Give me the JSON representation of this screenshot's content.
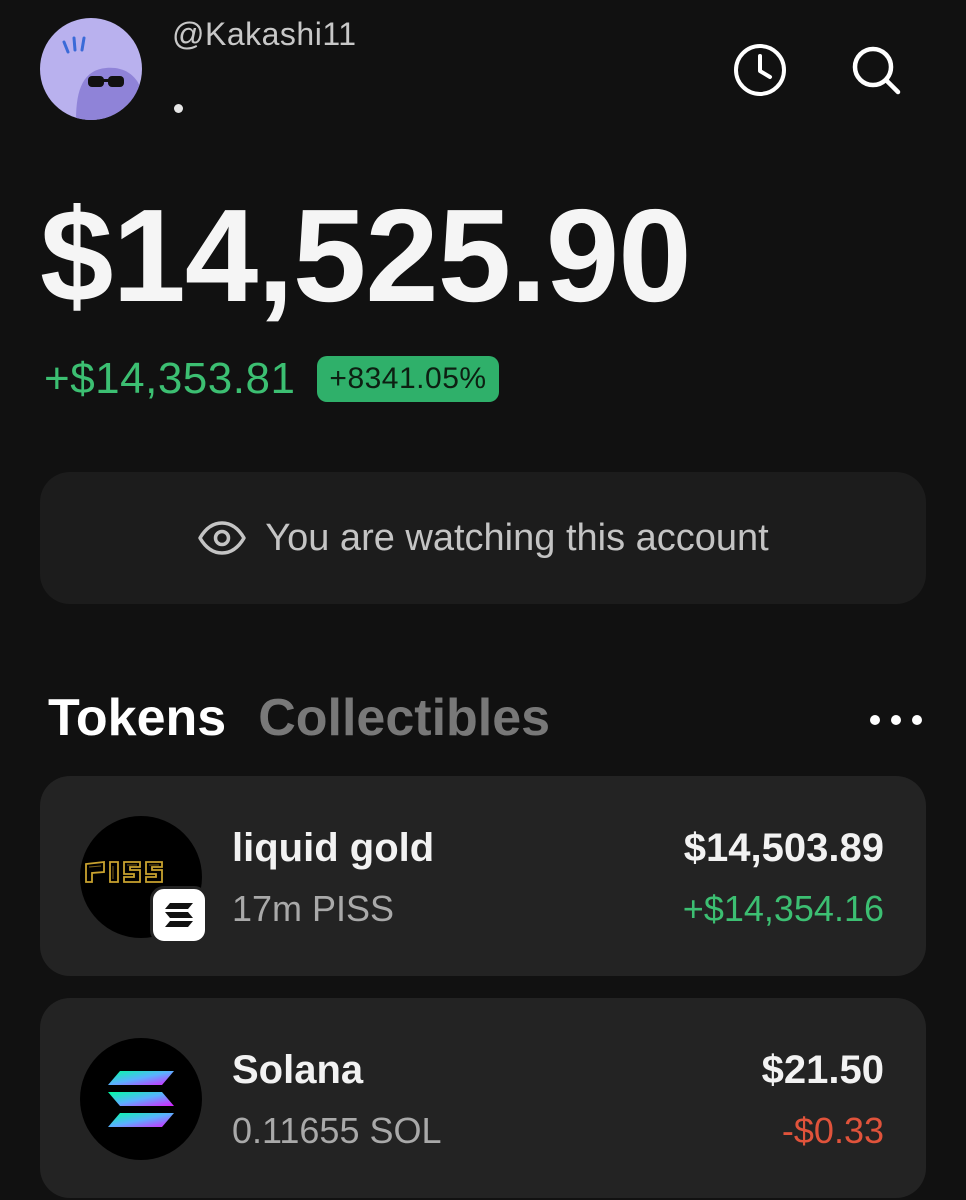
{
  "header": {
    "username": "@Kakashi11",
    "avatar_icon": "sunglasses-character-icon",
    "history_icon": "clock-icon",
    "search_icon": "search-icon"
  },
  "portfolio": {
    "balance": "$14,525.90",
    "change_amount": "+$14,353.81",
    "change_percent": "+8341.05%"
  },
  "watch_banner": {
    "icon": "eye-icon",
    "text": "You are watching this account"
  },
  "tabs": [
    {
      "label": "Tokens",
      "active": true
    },
    {
      "label": "Collectibles",
      "active": false
    }
  ],
  "more_icon": "ellipsis-icon",
  "tokens": [
    {
      "name": "liquid gold",
      "quantity": "17m PISS",
      "value": "$14,503.89",
      "change": "+$14,354.16",
      "change_color": "#3cbf72",
      "logo_icon": "piss-token-icon",
      "chain_badge_icon": "solana-chain-icon"
    },
    {
      "name": "Solana",
      "quantity": "0.11655 SOL",
      "value": "$21.50",
      "change": "-$0.33",
      "change_color": "#e0533b",
      "logo_icon": "solana-icon"
    }
  ],
  "colors": {
    "background": "#111111",
    "positive": "#3cbf72",
    "negative": "#e0533b",
    "badge": "#2fb06a",
    "card": "#232323"
  }
}
